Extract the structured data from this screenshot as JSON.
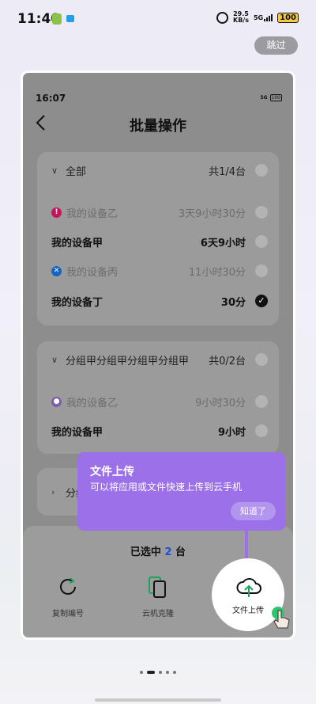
{
  "status_bar": {
    "time": "11:40",
    "net_speed_value": "29.5",
    "net_speed_unit": "KB/s",
    "signal": "5G",
    "battery": "100"
  },
  "skip_label": "跳过",
  "inner_status": {
    "time": "16:07",
    "signal": "5G",
    "battery": "100"
  },
  "page_title": "批量操作",
  "groups": [
    {
      "header": {
        "name": "全部",
        "count": "共1/4台"
      },
      "devices": [
        {
          "name": "我的设备乙",
          "time": "3天9小时30分",
          "status": "warning",
          "enabled": false,
          "checked": false
        },
        {
          "name": "我的设备甲",
          "time": "6天9小时",
          "status": "",
          "enabled": true,
          "checked": false
        },
        {
          "name": "我的设备丙",
          "time": "11小时30分",
          "status": "error",
          "enabled": false,
          "checked": false
        },
        {
          "name": "我的设备丁",
          "time": "30分",
          "status": "",
          "enabled": true,
          "checked": true
        }
      ]
    },
    {
      "header": {
        "name": "分组甲分组甲分组甲分组甲",
        "count": "共0/2台"
      },
      "devices": [
        {
          "name": "我的设备乙",
          "time": "9小时30分",
          "status": "purple",
          "enabled": false,
          "checked": false
        },
        {
          "name": "我的设备甲",
          "time": "9小时",
          "status": "",
          "enabled": true,
          "checked": false
        }
      ]
    },
    {
      "header": {
        "name": "分组"
      }
    }
  ],
  "selection": {
    "prefix": "已选中",
    "count": "2",
    "suffix": "台"
  },
  "actions": [
    {
      "label": "复制编号",
      "icon": "refresh-icon"
    },
    {
      "label": "云机克隆",
      "icon": "clone-icon"
    },
    {
      "label": "文件上传",
      "icon": "cloud-upload-icon"
    }
  ],
  "tooltip": {
    "title": "文件上传",
    "description": "可以将应用或文件快速上传到云手机",
    "button": "知道了"
  },
  "pager": {
    "count": 5,
    "active_index": 1
  },
  "colors": {
    "tooltip_bg": "#9b70e8",
    "selected_count": "#1e4fd8",
    "overlay_gray": "#8d8d8d",
    "skip_bg": "#9b9ba1",
    "highlight_dot": "#2ec56e"
  }
}
